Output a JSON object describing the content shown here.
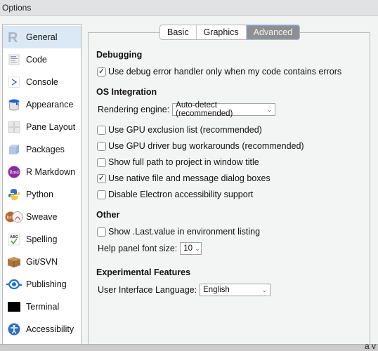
{
  "window": {
    "title": "Options"
  },
  "sidebar": {
    "selected": "General",
    "items": [
      {
        "label": "General",
        "icon": "r-logo-icon"
      },
      {
        "label": "Code",
        "icon": "code-icon"
      },
      {
        "label": "Console",
        "icon": "console-prompt-icon"
      },
      {
        "label": "Appearance",
        "icon": "paint-bucket-icon"
      },
      {
        "label": "Pane Layout",
        "icon": "pane-layout-icon"
      },
      {
        "label": "Packages",
        "icon": "package-box-icon"
      },
      {
        "label": "R Markdown",
        "icon": "rmd-icon"
      },
      {
        "label": "Python",
        "icon": "python-icon"
      },
      {
        "label": "Sweave",
        "icon": "sweave-icon"
      },
      {
        "label": "Spelling",
        "icon": "spelling-abc-icon"
      },
      {
        "label": "Git/SVN",
        "icon": "git-box-icon"
      },
      {
        "label": "Publishing",
        "icon": "publishing-icon"
      },
      {
        "label": "Terminal",
        "icon": "terminal-icon"
      },
      {
        "label": "Accessibility",
        "icon": "accessibility-icon"
      }
    ]
  },
  "tabs": {
    "items": [
      "Basic",
      "Graphics",
      "Advanced"
    ],
    "active": "Advanced"
  },
  "sections": {
    "debugging": {
      "title": "Debugging",
      "debug_handler": {
        "label": "Use debug error handler only when my code contains errors",
        "checked": true
      }
    },
    "os_integration": {
      "title": "OS Integration",
      "rendering_engine_label": "Rendering engine:",
      "rendering_engine_value": "Auto-detect (recommended)",
      "gpu_exclusion": {
        "label": "Use GPU exclusion list (recommended)",
        "checked": false
      },
      "gpu_workarounds": {
        "label": "Use GPU driver bug workarounds (recommended)",
        "checked": false
      },
      "full_path": {
        "label": "Show full path to project in window title",
        "checked": false
      },
      "native_dialogs": {
        "label": "Use native file and message dialog boxes",
        "checked": true
      },
      "disable_electron_a11y": {
        "label": "Disable Electron accessibility support",
        "checked": false
      }
    },
    "other": {
      "title": "Other",
      "last_value": {
        "label": "Show .Last.value in environment listing",
        "checked": false
      },
      "help_font_label": "Help panel font size:",
      "help_font_value": "10"
    },
    "experimental": {
      "title": "Experimental Features",
      "ui_language_label": "User Interface Language:",
      "ui_language_value": "English"
    }
  },
  "bottom_tail_text": "a v",
  "glyphs": {
    "check": "✓",
    "chevron": "﹀"
  }
}
